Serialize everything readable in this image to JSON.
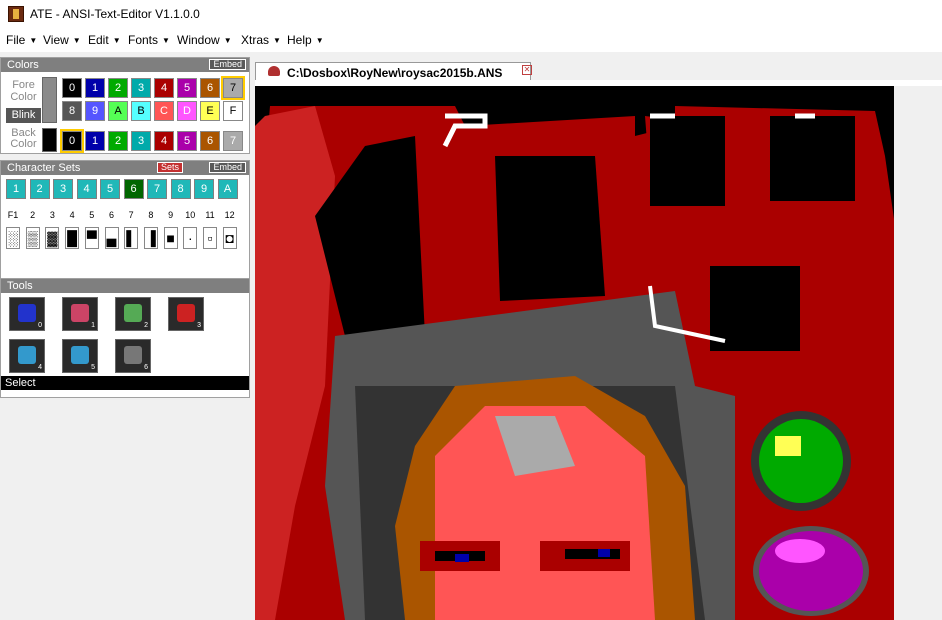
{
  "window": {
    "title": "ATE - ANSI-Text-Editor V1.1.0.0"
  },
  "menu": [
    {
      "label": "File"
    },
    {
      "label": "View"
    },
    {
      "label": "Edit"
    },
    {
      "label": "Fonts"
    },
    {
      "label": "Window"
    },
    {
      "label": "Xtras"
    },
    {
      "label": "Help"
    }
  ],
  "colors_panel": {
    "header": "Colors",
    "embed": "Embed",
    "fore_label": "Fore Color",
    "blink_label": "Blink",
    "back_label": "Back Color",
    "fore_row1": [
      {
        "label": "0",
        "bg": "#000000",
        "fg": "#ffffff"
      },
      {
        "label": "1",
        "bg": "#0000aa",
        "fg": "#ffffff"
      },
      {
        "label": "2",
        "bg": "#00aa00",
        "fg": "#ffffff"
      },
      {
        "label": "3",
        "bg": "#00aaaa",
        "fg": "#ffffff"
      },
      {
        "label": "4",
        "bg": "#aa0000",
        "fg": "#ffffff"
      },
      {
        "label": "5",
        "bg": "#aa00aa",
        "fg": "#ffffff"
      },
      {
        "label": "6",
        "bg": "#aa5500",
        "fg": "#ffffff"
      },
      {
        "label": "7",
        "bg": "#aaaaaa",
        "fg": "#000000"
      }
    ],
    "fore_row2": [
      {
        "label": "8",
        "bg": "#555555",
        "fg": "#ffffff"
      },
      {
        "label": "9",
        "bg": "#5555ff",
        "fg": "#ffffff"
      },
      {
        "label": "A",
        "bg": "#55ff55",
        "fg": "#000000"
      },
      {
        "label": "B",
        "bg": "#55ffff",
        "fg": "#000000"
      },
      {
        "label": "C",
        "bg": "#ff5555",
        "fg": "#ffffff"
      },
      {
        "label": "D",
        "bg": "#ff55ff",
        "fg": "#ffffff"
      },
      {
        "label": "E",
        "bg": "#ffff55",
        "fg": "#000000"
      },
      {
        "label": "F",
        "bg": "#ffffff",
        "fg": "#000000"
      }
    ],
    "back_row": [
      {
        "label": "0",
        "bg": "#000000",
        "fg": "#ffffff"
      },
      {
        "label": "1",
        "bg": "#0000aa",
        "fg": "#ffffff"
      },
      {
        "label": "2",
        "bg": "#00aa00",
        "fg": "#ffffff"
      },
      {
        "label": "3",
        "bg": "#00aaaa",
        "fg": "#ffffff"
      },
      {
        "label": "4",
        "bg": "#aa0000",
        "fg": "#ffffff"
      },
      {
        "label": "5",
        "bg": "#aa00aa",
        "fg": "#ffffff"
      },
      {
        "label": "6",
        "bg": "#aa5500",
        "fg": "#ffffff"
      },
      {
        "label": "7",
        "bg": "#aaaaaa",
        "fg": "#ffffff"
      }
    ]
  },
  "charsets_panel": {
    "header": "Character Sets",
    "sets_badge": "Sets",
    "embed": "Embed",
    "sets": [
      "1",
      "2",
      "3",
      "4",
      "5",
      "6",
      "7",
      "8",
      "9",
      "A"
    ],
    "active_set": "6",
    "fkeys": [
      "F1",
      "2",
      "3",
      "4",
      "5",
      "6",
      "7",
      "8",
      "9",
      "10",
      "11",
      "12"
    ]
  },
  "tools_panel": {
    "header": "Tools",
    "tools": [
      {
        "name": "select-tool-icon",
        "num": "0"
      },
      {
        "name": "eraser-tool-icon",
        "num": "1"
      },
      {
        "name": "paint-roller-tool-icon",
        "num": "2"
      },
      {
        "name": "gradient-tool-icon",
        "num": "3"
      },
      {
        "name": "eyedropper-tool-icon",
        "num": "4"
      },
      {
        "name": "fill-bucket-tool-icon",
        "num": "5"
      },
      {
        "name": "pencil-tool-icon",
        "num": "6"
      }
    ],
    "status": "Select"
  },
  "document": {
    "tab_title": "C:\\Dosbox\\RoyNew\\roysac2015b.ANS"
  }
}
